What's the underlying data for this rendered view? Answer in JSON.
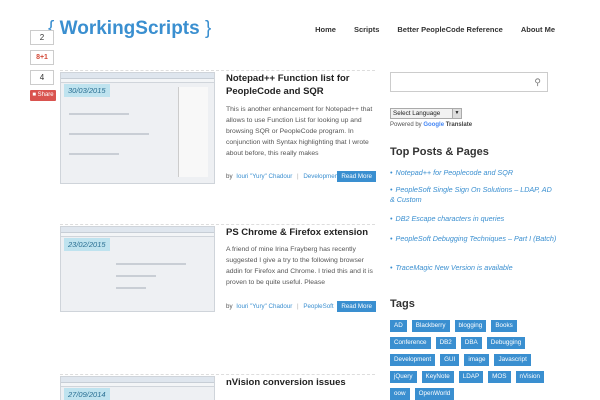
{
  "site": {
    "logo_brace_open": "{",
    "logo_text": "WorkingScripts",
    "logo_brace_close": "}"
  },
  "nav": {
    "items": [
      "Home",
      "Scripts",
      "Better PeopleCode Reference",
      "About Me"
    ]
  },
  "share": {
    "count_top": "2",
    "gplus_label": "8+1",
    "count_bottom": "4",
    "share_label": "■ Share"
  },
  "posts": [
    {
      "date": "30/03/2015",
      "title": "Notepad++ Function list for PeopleCode and SQR",
      "excerpt": "This is another enhancement for Notepad++ that allows to use Function List for looking up and browsing SQR or PeopleCode program. In conjunction with Syntax highlighting that I wrote about before, this really makes",
      "by": "by",
      "author": "Iouri \"Yury\" Chadour",
      "category": "Development",
      "read_more": "Read More"
    },
    {
      "date": "23/02/2015",
      "title": "PS Chrome & Firefox extension",
      "excerpt": "A friend of mine Irina Frayberg has recently suggested I give a try to the following browser addin for Firefox and Chrome. I tried this and it is proven to be quite useful. Please",
      "by": "by",
      "author": "Iouri \"Yury\" Chadour",
      "category": "PeopleSoft",
      "read_more": "Read More"
    },
    {
      "date": "27/09/2014",
      "title": "nVision conversion issues"
    }
  ],
  "sidebar": {
    "search_placeholder": "",
    "language_select": "Select Language",
    "powered_by": "Powered by",
    "google": "Google",
    "translate": "Translate",
    "top_posts_title": "Top Posts & Pages",
    "top_posts": [
      "Notepad++ for Peoplecode and SQR",
      "PeopleSoft Single Sign On Solutions – LDAP, AD & Custom",
      "DB2 Escape characters in queries",
      "PeopleSoft Debugging Techniques – Part I (Batch)",
      "TraceMagic New Version is available"
    ],
    "tags_title": "Tags",
    "tags": [
      "AD",
      "Blackberry",
      "blogging",
      "Books",
      "Conference",
      "DB2",
      "DBA",
      "Debugging",
      "Development",
      "GUI",
      "image",
      "Javascript",
      "jQuery",
      "KeyNote",
      "LDAP",
      "MOS",
      "nVision",
      "oow",
      "OpenWorld"
    ]
  },
  "colors": {
    "accent": "#3a8fd0",
    "date_badge_bg": "#bfe3ef",
    "share_red": "#d9534f"
  },
  "icons": {
    "search": "magnifier-icon"
  }
}
